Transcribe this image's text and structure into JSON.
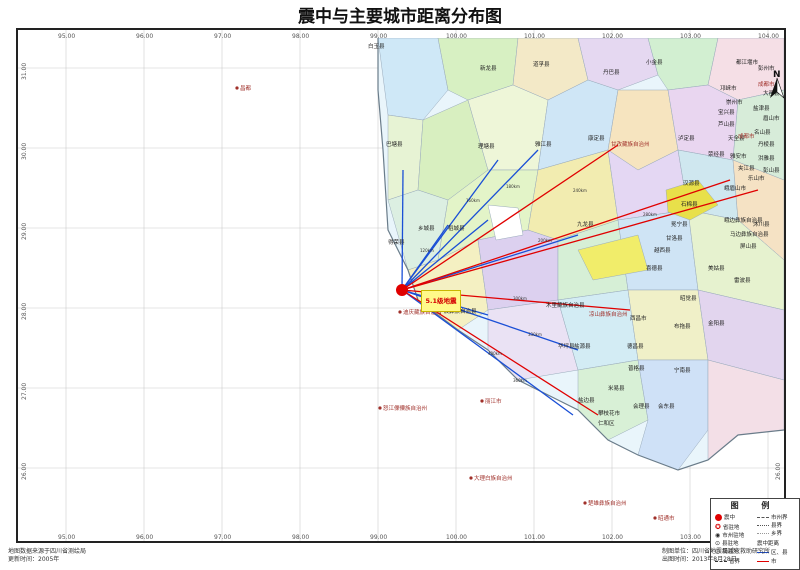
{
  "title": "震中与主要城市距离分布图",
  "longitude_ticks": [
    "95.00",
    "96.00",
    "97.00",
    "98.00",
    "99.00",
    "100.00",
    "101.00",
    "102.00",
    "103.00",
    "104.00"
  ],
  "latitude_ticks": [
    "31.00",
    "30.00",
    "29.00",
    "28.00",
    "27.00",
    "26.00"
  ],
  "epicenter": {
    "label": "5.1级地震"
  },
  "counties": [
    "白玉县",
    "新龙县",
    "道孚县",
    "金川县",
    "小金县",
    "丹巴县",
    "都江堰市",
    "彭州市",
    "巴塘县",
    "理塘县",
    "雅江县",
    "康定县",
    "泸定县",
    "汉源县",
    "石棉县",
    "冕宁县",
    "九龙县",
    "乡城县",
    "稻城县",
    "得荣县",
    "木里藏族自治县",
    "盐源县",
    "西昌市",
    "德昌县",
    "米易县",
    "盐边县",
    "会理县",
    "会东县",
    "宁南县",
    "普格县",
    "布拖县",
    "金阳县",
    "昭觉县",
    "喜德县",
    "越西县",
    "甘洛县",
    "美姑县",
    "雷波县",
    "马边彝族自治县",
    "峨边彝族自治县",
    "沐川县",
    "屏山县",
    "宁蒗彝族自治县",
    "华坪县",
    "攀枝花市",
    "仁和区",
    "盐津县",
    "邛崃市",
    "崇州市",
    "大邑县",
    "名山县",
    "天全县",
    "芦山县",
    "宝兴县",
    "荥经县",
    "雅安市",
    "洪雅县",
    "乐山市",
    "夹江县",
    "峨眉山市",
    "丹棱县",
    "眉山市",
    "彭山县",
    "成都市"
  ],
  "map_labels": [
    "昌都",
    "迪庆藏族自治州",
    "怒江傈僳族自治州",
    "丽江市",
    "大理白族自治州",
    "楚雄彝族自治州",
    "甘孜藏族自治州",
    "凉山彝族自治州",
    "昭通市",
    "成都市"
  ],
  "distance_labels": [
    "120km",
    "160km",
    "180km",
    "200km",
    "240km",
    "280km",
    "300km",
    "330km",
    "360km",
    "400km"
  ],
  "legend": {
    "title": "图 例",
    "items": [
      {
        "label": "震中",
        "icon": "epicenter-dot"
      },
      {
        "label": "省驻地",
        "icon": "provincial-capital-icon"
      },
      {
        "label": "市州驻地",
        "icon": "prefecture-seat-icon"
      },
      {
        "label": "县驻地",
        "icon": "county-seat-icon"
      },
      {
        "label": "镇驻地",
        "icon": "town-icon"
      },
      {
        "label": "省界",
        "icon": "province-boundary-line"
      },
      {
        "label": "市州界",
        "icon": "prefecture-boundary-line"
      },
      {
        "label": "县界",
        "icon": "county-boundary-line"
      },
      {
        "label": "乡界",
        "icon": "township-boundary-line"
      },
      {
        "label": "震中距离",
        "icon": "distance-heading"
      },
      {
        "label": "区、县",
        "icon": "blue-line"
      },
      {
        "label": "市",
        "icon": "red-line"
      }
    ]
  },
  "footer": {
    "left_line1": "地图数据来源于四川省测绘局",
    "left_line2": "更新时间：2005年",
    "right_line1": "制图单位：四川省地震局减灾救助研究所",
    "right_line2": "出图时间：2013年8月28日"
  },
  "colors": {
    "epicenter": "#e00000",
    "city_line": "#e00000",
    "county_line": "#1a4fd6",
    "frame": "#222222"
  }
}
